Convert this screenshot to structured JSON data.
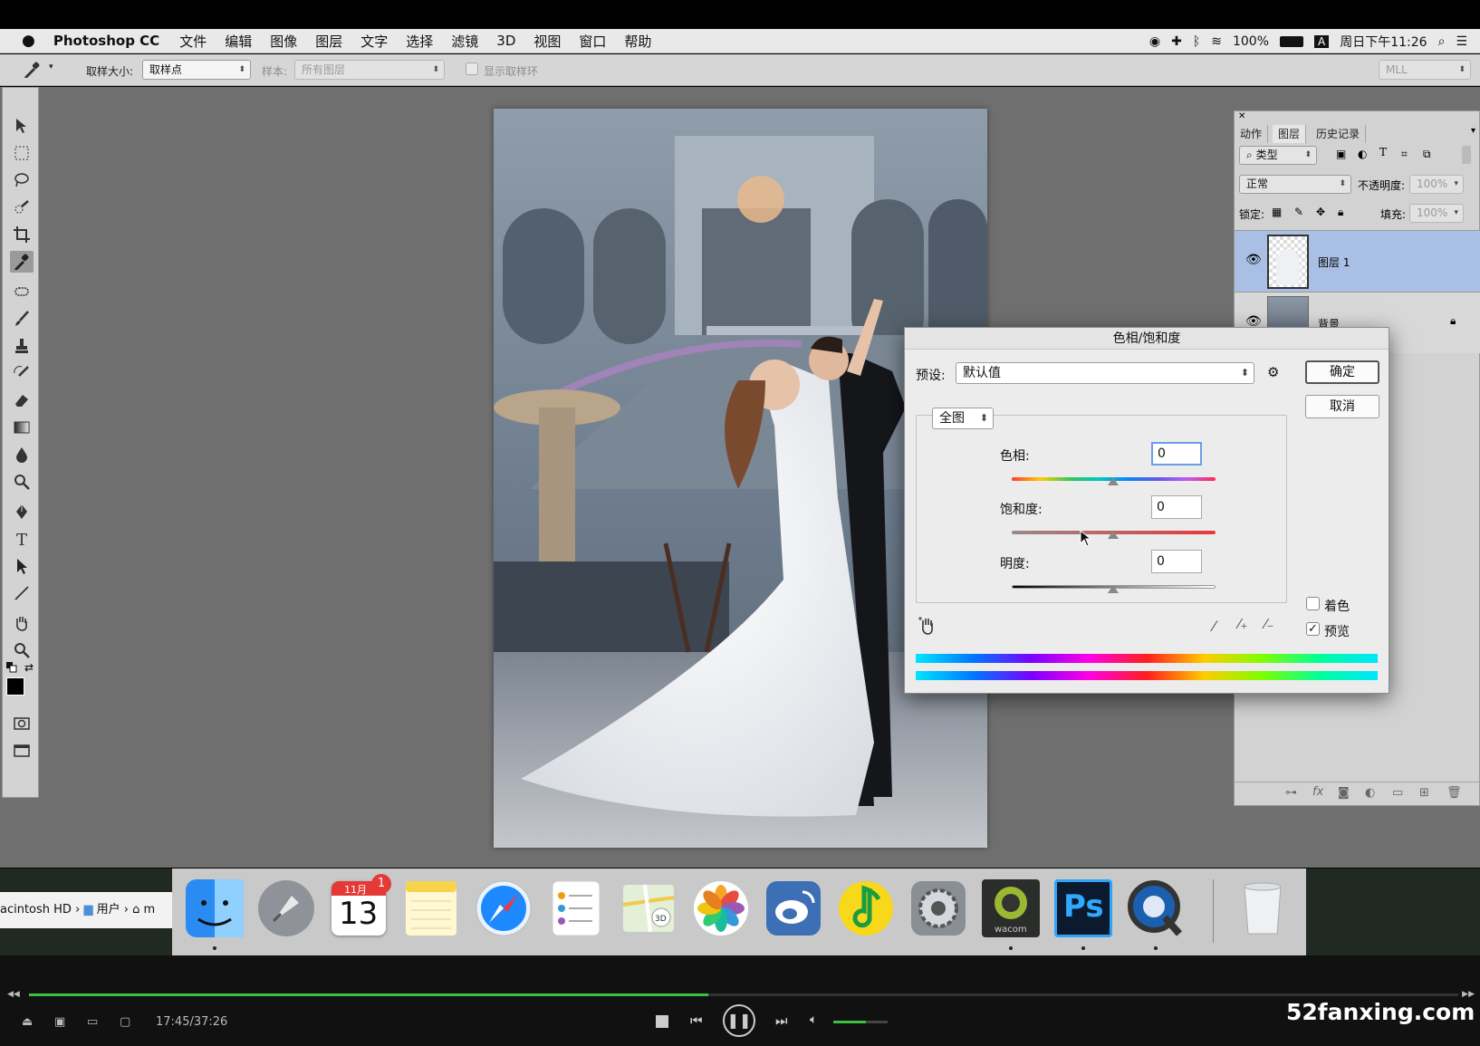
{
  "menubar": {
    "app_name": "Photoshop CC",
    "menus": [
      "文件",
      "编辑",
      "图像",
      "图层",
      "文字",
      "选择",
      "滤镜",
      "3D",
      "视图",
      "窗口",
      "帮助"
    ],
    "battery": "100%",
    "input_method": "A",
    "clock": "周日下午11:26"
  },
  "options_bar": {
    "sample_size_label": "取样大小:",
    "sample_size_value": "取样点",
    "sample_label": "样本:",
    "sample_value": "所有图层",
    "show_ring_label": "显示取样环",
    "workspace_value": "MLL"
  },
  "layers_panel": {
    "tabs": [
      "动作",
      "图层",
      "历史记录"
    ],
    "active_tab": "图层",
    "filter_label": "类型",
    "blend_mode": "正常",
    "opacity_label": "不透明度:",
    "opacity_value": "100%",
    "lock_label": "锁定:",
    "fill_label": "填充:",
    "fill_value": "100%",
    "layers": [
      {
        "name": "图层 1",
        "selected": true
      },
      {
        "name": "背景",
        "selected": false,
        "locked": true
      }
    ]
  },
  "dialog": {
    "title": "色相/饱和度",
    "preset_label": "预设:",
    "preset_value": "默认值",
    "ok_label": "确定",
    "cancel_label": "取消",
    "channel_value": "全图",
    "hue_label": "色相:",
    "hue_value": "0",
    "saturation_label": "饱和度:",
    "saturation_value": "0",
    "lightness_label": "明度:",
    "lightness_value": "0",
    "colorize_label": "着色",
    "colorize_checked": false,
    "preview_label": "预览",
    "preview_checked": true
  },
  "finder": {
    "path": [
      "acintosh HD",
      "用户",
      "m"
    ]
  },
  "dock": {
    "calendar_month": "11月",
    "calendar_day": "13",
    "calendar_badge": "1",
    "ps_label": "Ps",
    "wacom_label": "wacom"
  },
  "player": {
    "time": "17:45/37:26",
    "progress": 0.475,
    "volume": 0.6,
    "watermark": "52fanxing.com"
  },
  "colors": {
    "selected_layer": "#a9bfe3",
    "focus_ring": "#6a9ee8",
    "progress": "#3fbf3f"
  }
}
